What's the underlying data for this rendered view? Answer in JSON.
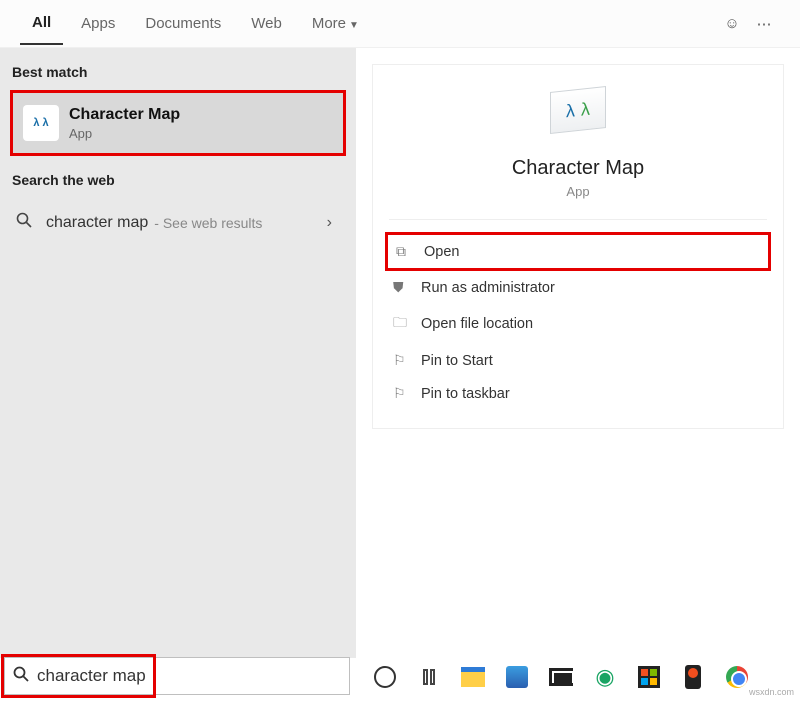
{
  "tabs": {
    "all": "All",
    "apps": "Apps",
    "documents": "Documents",
    "web": "Web",
    "more": "More"
  },
  "left": {
    "best_match_label": "Best match",
    "best_match": {
      "title": "Character Map",
      "subtitle": "App"
    },
    "search_web_label": "Search the web",
    "web_query": "character map",
    "web_hint": "- See web results"
  },
  "detail": {
    "title": "Character Map",
    "subtitle": "App",
    "actions": {
      "open": "Open",
      "admin": "Run as administrator",
      "location": "Open file location",
      "pin_start": "Pin to Start",
      "pin_taskbar": "Pin to taskbar"
    }
  },
  "search": {
    "value": "character map"
  },
  "watermark": "wsxdn.com"
}
